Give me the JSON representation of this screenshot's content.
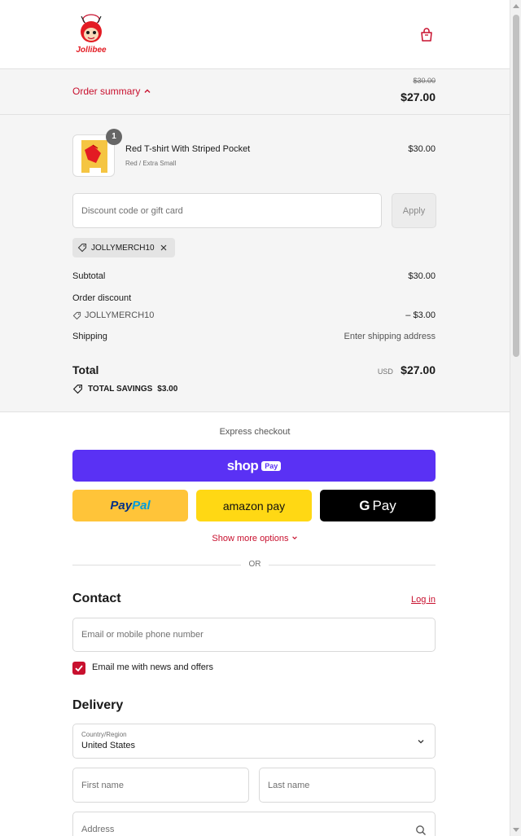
{
  "header": {
    "logo_text": "Jollibee"
  },
  "summary_toggle": {
    "label": "Order summary",
    "original_price": "$30.00",
    "price": "$27.00"
  },
  "line_item": {
    "quantity": "1",
    "name": "Red T-shirt With Striped Pocket",
    "variant": "Red / Extra Small",
    "price": "$30.00"
  },
  "discount": {
    "placeholder": "Discount code or gift card",
    "apply_label": "Apply",
    "applied_code": "JOLLYMERCH10"
  },
  "totals": {
    "subtotal_label": "Subtotal",
    "subtotal_value": "$30.00",
    "order_discount_label": "Order discount",
    "order_discount_code": "JOLLYMERCH10",
    "order_discount_value": "– $3.00",
    "shipping_label": "Shipping",
    "shipping_value": "Enter shipping address",
    "total_label": "Total",
    "total_currency": "USD",
    "total_value": "$27.00",
    "savings_label": "TOTAL SAVINGS",
    "savings_value": "$3.00"
  },
  "express": {
    "title": "Express checkout",
    "shop_label": "shop",
    "shop_pay_badge": "Pay",
    "paypal_a": "Pay",
    "paypal_b": "Pal",
    "amazon_label": "amazon pay",
    "gpay_g": "G",
    "gpay_label": "Pay",
    "show_more": "Show more options",
    "or": "OR"
  },
  "contact": {
    "title": "Contact",
    "login": "Log in",
    "email_placeholder": "Email or mobile phone number",
    "newsletter": "Email me with news and offers"
  },
  "delivery": {
    "title": "Delivery",
    "country_label": "Country/Region",
    "country_value": "United States",
    "first_name": "First name",
    "last_name": "Last name",
    "address": "Address"
  },
  "colors": {
    "accent": "#c8102e",
    "shop_pay": "#5a31f4",
    "paypal": "#ffc439",
    "amazon": "#ffd814"
  }
}
